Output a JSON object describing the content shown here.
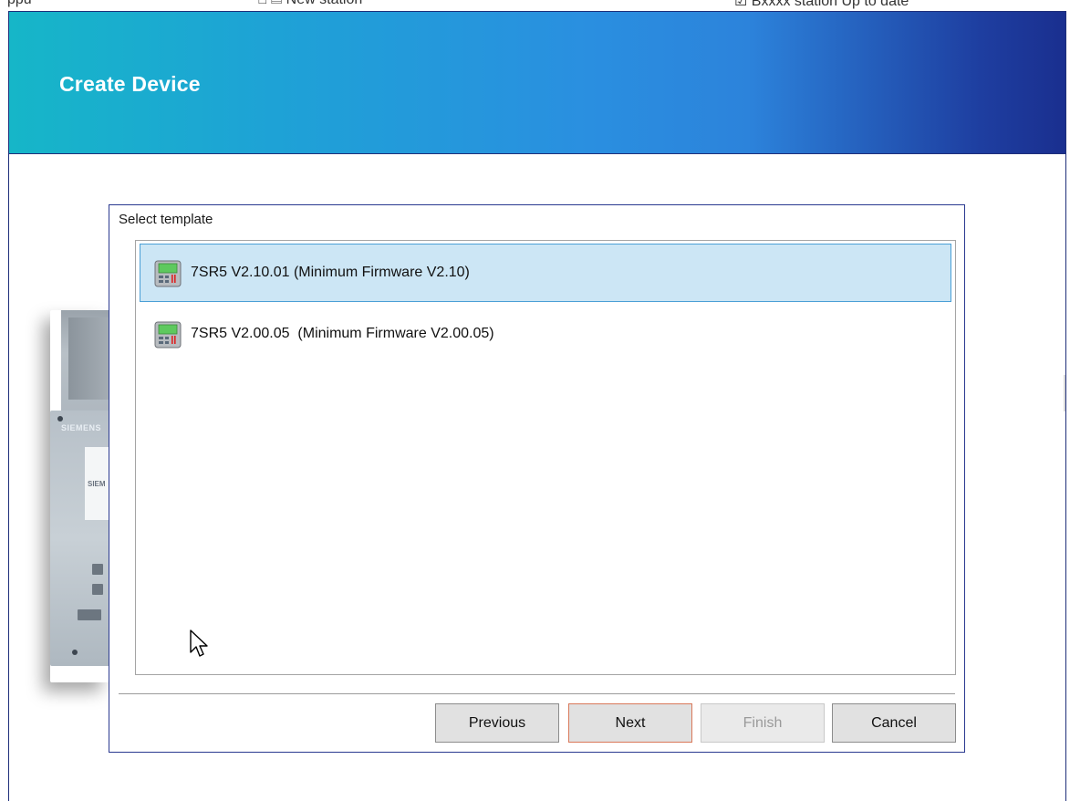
{
  "background_window": {
    "text_left": "ppu",
    "text_middle": "⎕ ▤ New station",
    "text_right": "☑ Bxxxx station Up to date"
  },
  "wizard": {
    "title": "Create Device",
    "header_gradient": [
      "#16b6c8",
      "#2a8fe0",
      "#1a2f8f"
    ]
  },
  "device_image": {
    "brand": "SIEMENS",
    "screen_text": "SIEM"
  },
  "dialog": {
    "label": "Select template",
    "templates": [
      {
        "label": "7SR5 V2.10.01 (Minimum Firmware V2.10)",
        "selected": true,
        "icon": "device-relay-icon"
      },
      {
        "label": "7SR5 V2.00.05  (Minimum Firmware V2.00.05)",
        "selected": false,
        "icon": "device-relay-icon"
      }
    ],
    "buttons": {
      "previous": "Previous",
      "next": "Next",
      "finish": "Finish",
      "cancel": "Cancel"
    }
  },
  "colors": {
    "selection_bg": "#cce6f5",
    "selection_border": "#4a9fd6",
    "dialog_border": "#2a3990",
    "next_border": "#d9785a"
  }
}
